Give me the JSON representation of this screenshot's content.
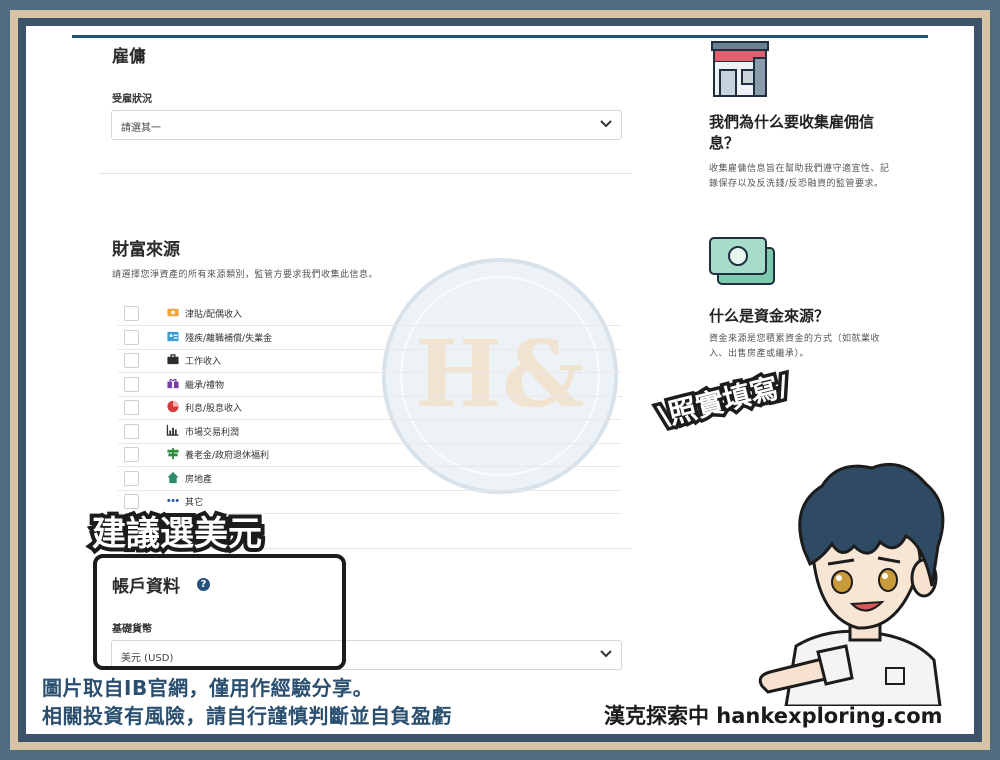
{
  "employment": {
    "title": "雇傭",
    "status_label": "受雇狀況",
    "status_value": "請選其一"
  },
  "wealth": {
    "title": "財富來源",
    "description": "請選擇您淨資產的所有來源類別，監管方要求我們收集此信息。",
    "items": [
      {
        "label": "津貼/配偶收入",
        "icon": "money-bill-icon",
        "color": "#f2a33a"
      },
      {
        "label": "殘疾/離職補償/失業金",
        "icon": "id-card-icon",
        "color": "#3c9ad6"
      },
      {
        "label": "工作收入",
        "icon": "briefcase-icon",
        "color": "#2d2d2d"
      },
      {
        "label": "繼承/禮物",
        "icon": "gift-icon",
        "color": "#7a3ea8"
      },
      {
        "label": "利息/股息收入",
        "icon": "pie-chart-icon",
        "color": "#d63a3a"
      },
      {
        "label": "市場交易利潤",
        "icon": "bar-chart-icon",
        "color": "#333333"
      },
      {
        "label": "養老金/政府退休福利",
        "icon": "signpost-icon",
        "color": "#2e8b3a"
      },
      {
        "label": "房地產",
        "icon": "house-icon",
        "color": "#2e8b6a"
      },
      {
        "label": "其它",
        "icon": "more-dots-icon",
        "color": "#2a5aa8"
      }
    ]
  },
  "account": {
    "title": "帳戶資料",
    "help_glyph": "?",
    "currency_label": "基礎貨幣",
    "currency_value": "美元 (USD)"
  },
  "side": {
    "employment_title": "我們為什么要收集雇佣信息？",
    "employment_desc": "收集雇傭信息旨在幫助我們遵守適宜性、記錄保存以及反洗錢/反恐融資的監管要求。",
    "wealth_title": "什么是資金來源？",
    "wealth_desc": "資金來源是您積累資金的方式（如就業收入、出售房產或繼承）。"
  },
  "overlay": {
    "watermark": "H&",
    "callout_text": "建議選美元",
    "speech_text": "\\照實填寫/",
    "note_line1": "圖片取自IB官網，僅用作經驗分享。",
    "note_line2": "相關投資有風險，請自行謹慎判斷並自負盈虧",
    "credit": "漢克探索中 hankexploring.com"
  },
  "colors": {
    "frame_outer": "#4f6b80",
    "frame_beige": "#d9c3a6",
    "frame_inner": "#3b5368",
    "accent": "#24507a",
    "money_green": "#7fc9ae"
  }
}
